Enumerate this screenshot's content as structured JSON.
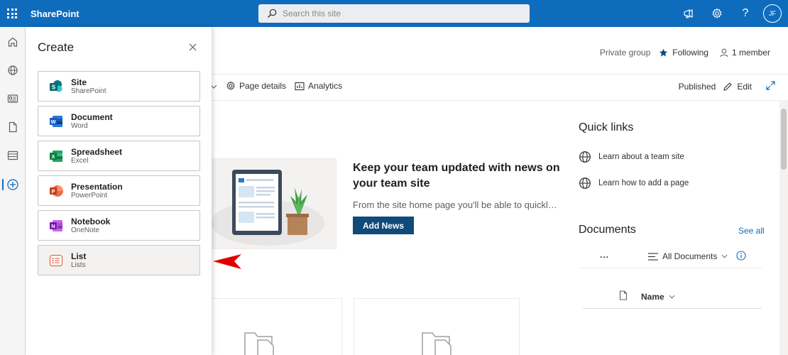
{
  "suite": {
    "brand": "SharePoint",
    "search_placeholder": "Search this site",
    "avatar_initials": "JF",
    "icons": [
      "megaphone-icon",
      "gear-icon",
      "help-icon"
    ]
  },
  "appbar": {
    "items": [
      "home-icon",
      "globe-icon",
      "news-icon",
      "file-icon",
      "list-icon",
      "create-icon"
    ],
    "active": "create-icon"
  },
  "site_header": {
    "group_type": "Private group",
    "following": "Following",
    "members": "1 member"
  },
  "command_bar": {
    "page_details": "Page details",
    "analytics": "Analytics",
    "status": "Published",
    "edit": "Edit"
  },
  "news": {
    "title": "Keep your team updated with news on your team site",
    "description": "From the site home page you'll be able to quickly author a news post",
    "button": "Add News"
  },
  "quick_links": {
    "title": "Quick links",
    "items": [
      "Learn about a team site",
      "Learn how to add a page"
    ]
  },
  "documents": {
    "title": "Documents",
    "see_all": "See all",
    "more": "...",
    "view": "All Documents",
    "column_name": "Name"
  },
  "create_panel": {
    "title": "Create",
    "items": [
      {
        "title": "Site",
        "subtitle": "SharePoint",
        "icon": "sharepoint-icon",
        "color": "#038387"
      },
      {
        "title": "Document",
        "subtitle": "Word",
        "icon": "word-icon",
        "color": "#185abd"
      },
      {
        "title": "Spreadsheet",
        "subtitle": "Excel",
        "icon": "excel-icon",
        "color": "#107c41"
      },
      {
        "title": "Presentation",
        "subtitle": "PowerPoint",
        "icon": "powerpoint-icon",
        "color": "#c43e1c"
      },
      {
        "title": "Notebook",
        "subtitle": "OneNote",
        "icon": "onenote-icon",
        "color": "#7719aa"
      },
      {
        "title": "List",
        "subtitle": "Lists",
        "icon": "lists-icon",
        "color": "#d9542b"
      }
    ],
    "highlighted": "List"
  },
  "colors": {
    "suite_blue": "#0f6cbd",
    "add_news_button": "#0f4a7a",
    "annotation_arrow": "#e00000"
  }
}
